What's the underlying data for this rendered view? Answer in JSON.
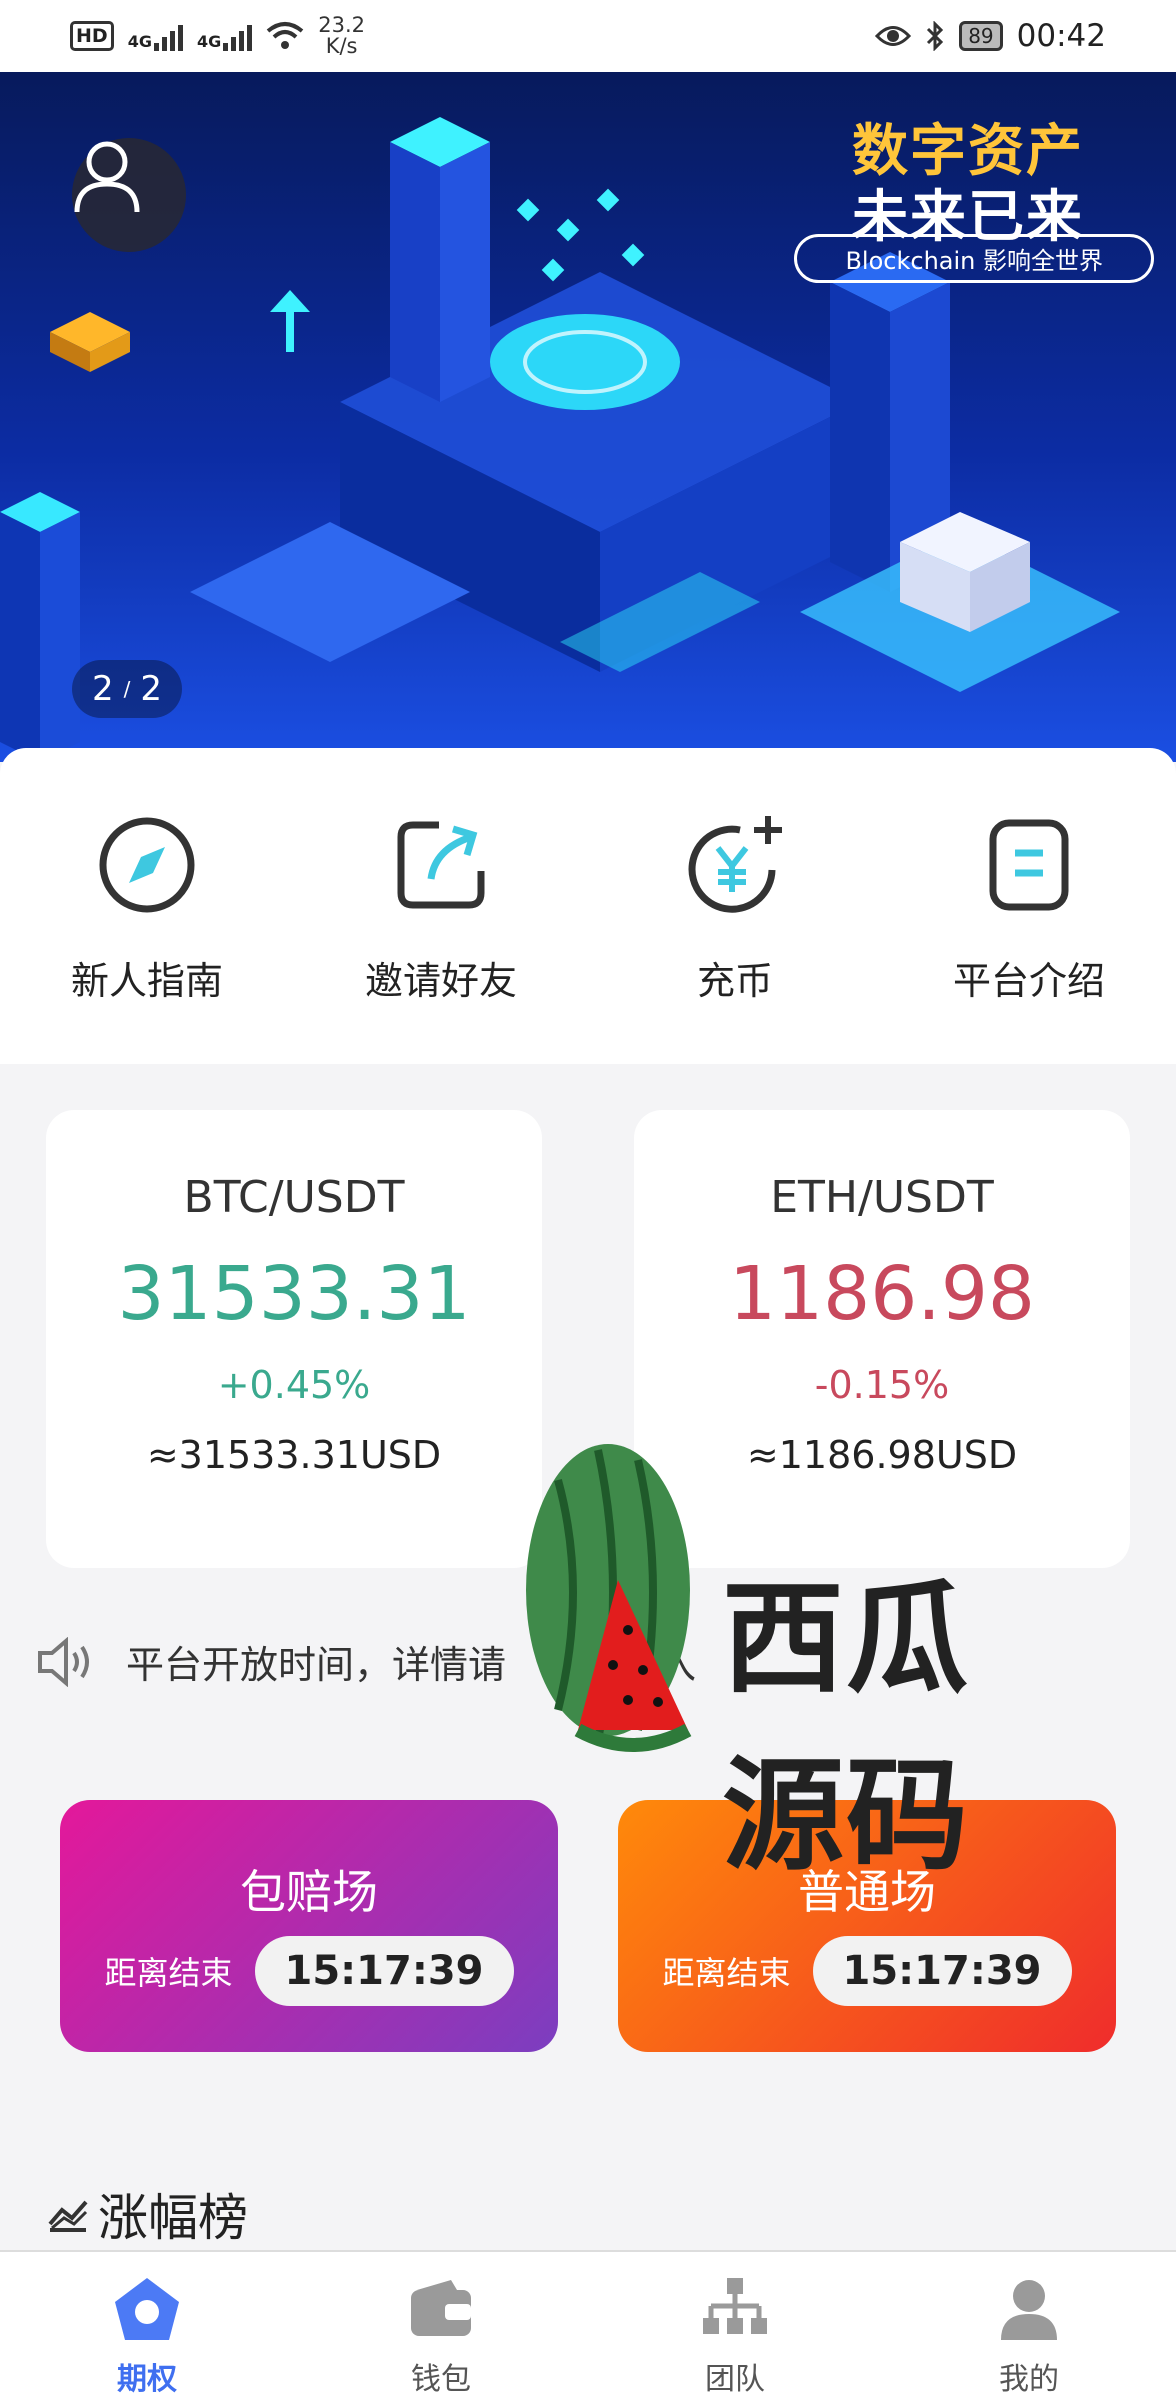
{
  "status_bar": {
    "network_badge": "HD",
    "signal_1": "4G",
    "signal_2": "4G",
    "speed_value": "23.2",
    "speed_unit": "K/s",
    "battery": "89",
    "time": "00:42"
  },
  "banner": {
    "slogan_top": "数字资产",
    "slogan_main": "未来已来",
    "slogan_tagline": "Blockchain 影响全世界",
    "page_current": "2",
    "page_sep": "/",
    "page_total": "2"
  },
  "quick_menu": [
    {
      "label": "新人指南",
      "icon": "compass-icon"
    },
    {
      "label": "邀请好友",
      "icon": "share-icon"
    },
    {
      "label": "充币",
      "icon": "yuan-add-icon"
    },
    {
      "label": "平台介绍",
      "icon": "document-icon"
    }
  ],
  "tickers": [
    {
      "pair": "BTC/USDT",
      "price": "31533.31",
      "change": "+0.45%",
      "usd": "≈31533.31USD",
      "color": "#3aa98e"
    },
    {
      "pair": "ETH/USDT",
      "price": "1186.98",
      "change": "-0.15%",
      "usd": "≈1186.98USD",
      "color": "#c8495d"
    }
  ],
  "notice": {
    "text": "平台开放时间，详情请",
    "tail": "入"
  },
  "arenas": [
    {
      "title": "包赔场",
      "countdown_label": "距离结束",
      "countdown": "15:17:39",
      "gradient": [
        "#e4189a",
        "#7b3ec0"
      ]
    },
    {
      "title": "普通场",
      "countdown_label": "距离结束",
      "countdown": "15:17:39",
      "gradient": [
        "#ff8a0a",
        "#ef2c2c"
      ]
    }
  ],
  "section": {
    "title": "涨幅榜"
  },
  "watermark": {
    "text": "西瓜源码"
  },
  "tabbar": [
    {
      "label": "期权",
      "icon": "home-icon",
      "active": true
    },
    {
      "label": "钱包",
      "icon": "wallet-icon",
      "active": false
    },
    {
      "label": "团队",
      "icon": "team-icon",
      "active": false
    },
    {
      "label": "我的",
      "icon": "profile-icon",
      "active": false
    }
  ],
  "colors": {
    "accent": "#3f6ff0",
    "up": "#3aa98e",
    "down": "#c8495d",
    "banner_bg": "#0c2ca3"
  }
}
